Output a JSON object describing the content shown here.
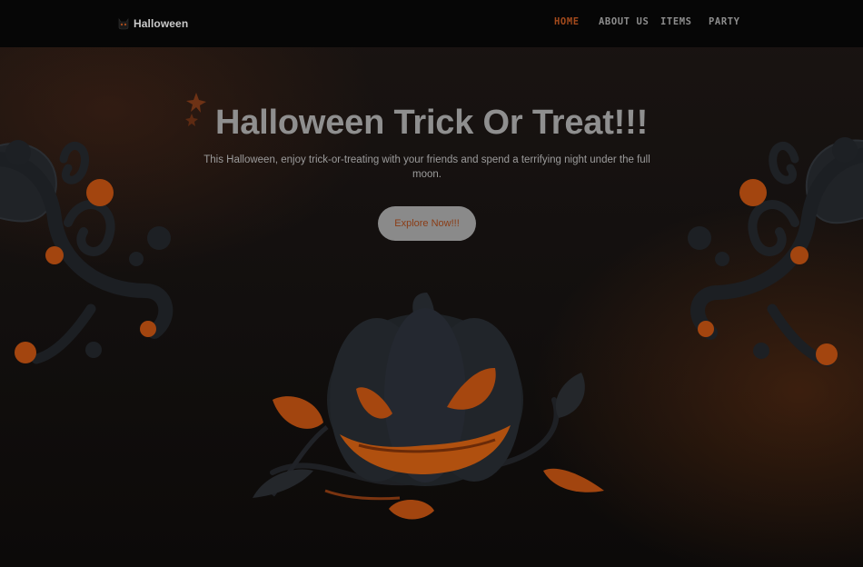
{
  "nav": {
    "brand": "Halloween",
    "items": [
      {
        "label": "HOME",
        "active": true
      },
      {
        "label": "ABOUT US",
        "active": false
      },
      {
        "label": "ITEMS",
        "active": false
      },
      {
        "label": "PARTY",
        "active": false
      }
    ]
  },
  "hero": {
    "title": "Halloween Trick Or Treat!!!",
    "description": "This Halloween, enjoy trick-or-treating with your friends and spend a terrifying night under the full moon.",
    "cta_label": "Explore Now!!!"
  },
  "colors": {
    "accent_orange": "#a34a1c",
    "navbar": "#060606",
    "background": "#120f0e",
    "button": "#8a8a8a"
  }
}
